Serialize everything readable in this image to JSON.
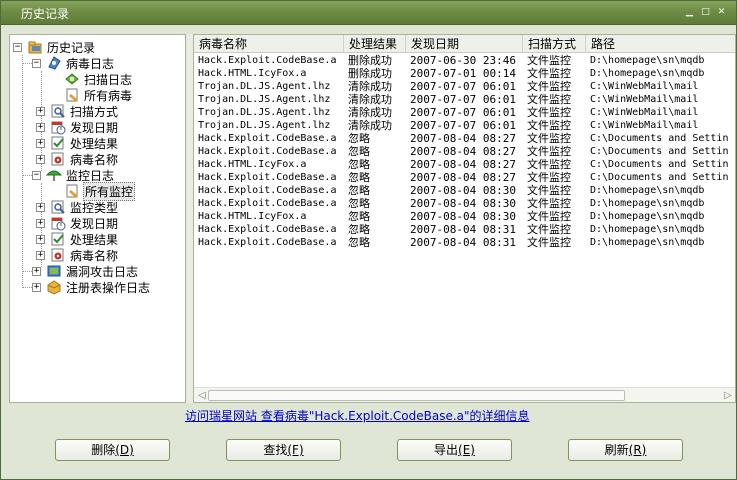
{
  "window": {
    "title": "历史记录",
    "minimize_glyph": "▁",
    "maximize_glyph": "□",
    "close_glyph": "✕"
  },
  "tree": {
    "root": "历史记录",
    "virus_log": {
      "label": "病毒日志",
      "children": [
        "扫描日志",
        "所有病毒",
        "扫描方式",
        "发现日期",
        "处理结果",
        "病毒名称"
      ]
    },
    "monitor_log": {
      "label": "监控日志",
      "children": [
        "所有监控",
        "监控类型",
        "发现日期",
        "处理结果",
        "病毒名称"
      ]
    },
    "exploit_log": "漏洞攻击日志",
    "registry_log": "注册表操作日志"
  },
  "list": {
    "columns": [
      "病毒名称",
      "处理结果",
      "发现日期",
      "扫描方式",
      "路径"
    ],
    "rows": [
      [
        "Hack.Exploit.CodeBase.a",
        "删除成功",
        "2007-06-30 23:46",
        "文件监控",
        "D:\\homepage\\sn\\mqdb"
      ],
      [
        "Hack.HTML.IcyFox.a",
        "删除成功",
        "2007-07-01 00:14",
        "文件监控",
        "D:\\homepage\\sn\\mqdb"
      ],
      [
        "Trojan.DL.JS.Agent.lhz",
        "清除成功",
        "2007-07-07 06:01",
        "文件监控",
        "C:\\WinWebMail\\mail"
      ],
      [
        "Trojan.DL.JS.Agent.lhz",
        "清除成功",
        "2007-07-07 06:01",
        "文件监控",
        "C:\\WinWebMail\\mail"
      ],
      [
        "Trojan.DL.JS.Agent.lhz",
        "清除成功",
        "2007-07-07 06:01",
        "文件监控",
        "C:\\WinWebMail\\mail"
      ],
      [
        "Trojan.DL.JS.Agent.lhz",
        "清除成功",
        "2007-07-07 06:01",
        "文件监控",
        "C:\\WinWebMail\\mail"
      ],
      [
        "Hack.Exploit.CodeBase.a",
        "忽略",
        "2007-08-04 08:27",
        "文件监控",
        "C:\\Documents and Settin"
      ],
      [
        "Hack.Exploit.CodeBase.a",
        "忽略",
        "2007-08-04 08:27",
        "文件监控",
        "C:\\Documents and Settin"
      ],
      [
        "Hack.HTML.IcyFox.a",
        "忽略",
        "2007-08-04 08:27",
        "文件监控",
        "C:\\Documents and Settin"
      ],
      [
        "Hack.Exploit.CodeBase.a",
        "忽略",
        "2007-08-04 08:27",
        "文件监控",
        "C:\\Documents and Settin"
      ],
      [
        "Hack.Exploit.CodeBase.a",
        "忽略",
        "2007-08-04 08:30",
        "文件监控",
        "D:\\homepage\\sn\\mqdb"
      ],
      [
        "Hack.Exploit.CodeBase.a",
        "忽略",
        "2007-08-04 08:30",
        "文件监控",
        "D:\\homepage\\sn\\mqdb"
      ],
      [
        "Hack.HTML.IcyFox.a",
        "忽略",
        "2007-08-04 08:30",
        "文件监控",
        "D:\\homepage\\sn\\mqdb"
      ],
      [
        "Hack.Exploit.CodeBase.a",
        "忽略",
        "2007-08-04 08:31",
        "文件监控",
        "D:\\homepage\\sn\\mqdb"
      ],
      [
        "Hack.Exploit.CodeBase.a",
        "忽略",
        "2007-08-04 08:31",
        "文件监控",
        "D:\\homepage\\sn\\mqdb"
      ]
    ]
  },
  "info_link": "访问瑞星网站 查看病毒\"Hack.Exploit.CodeBase.a\"的详细信息",
  "buttons": {
    "delete": "删除",
    "delete_key": "(D)",
    "find": "查找",
    "find_key": "(F)",
    "export": "导出",
    "export_key": "(E)",
    "refresh": "刷新",
    "refresh_key": "(R)"
  }
}
